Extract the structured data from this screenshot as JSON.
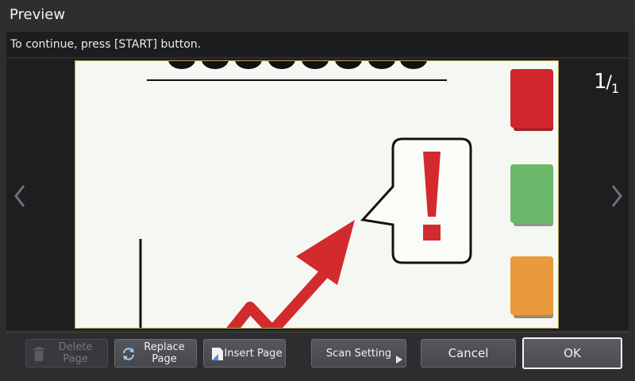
{
  "window": {
    "title": "Preview"
  },
  "message": "To continue, press [START] button.",
  "pagination": {
    "current": "1",
    "separator": "/",
    "total": "1"
  },
  "buttons": {
    "delete_page": "Delete\nPage",
    "replace_page": "Replace\nPage",
    "insert_page": "Insert Page",
    "scan_setting": "Scan Setting",
    "cancel": "Cancel",
    "ok": "OK"
  },
  "icons": {
    "prev": "chevron-left-icon",
    "next": "chevron-right-icon",
    "trash": "trash-icon",
    "replace": "refresh-icon",
    "insert": "insert-page-icon",
    "expand": "triangle-right-icon"
  },
  "colors": {
    "accent_red": "#d32a2e",
    "tab_red": "#d0262c",
    "tab_green": "#6cb86a",
    "tab_orange": "#e99a3a"
  }
}
